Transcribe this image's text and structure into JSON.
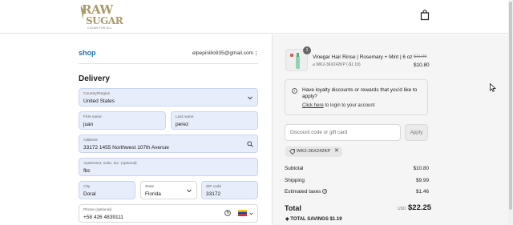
{
  "brand": {
    "logo_word_1": "RAW",
    "logo_word_2": "SUGAR",
    "tagline": "CLEAN FOR ALL"
  },
  "header": {
    "bag_icon": "shopping-bag-icon"
  },
  "account": {
    "shop_label": "shop",
    "email": "elpepinillo935@gmail.com",
    "menu_glyph": "⋮"
  },
  "delivery": {
    "title": "Delivery",
    "country": {
      "label": "Country/Region",
      "value": "United States"
    },
    "first_name": {
      "label": "First name",
      "value": "juan"
    },
    "last_name": {
      "label": "Last name",
      "value": "perez"
    },
    "address": {
      "label": "Address",
      "value": "33172 1455 Northwest 107th Avenue"
    },
    "apartment": {
      "label": "Apartment, suite, etc. (optional)",
      "value": "fbc"
    },
    "city": {
      "label": "City",
      "value": "Doral"
    },
    "state": {
      "label": "State",
      "value": "Florida"
    },
    "zip": {
      "label": "ZIP code",
      "value": "33172"
    },
    "phone": {
      "label": "Phone (optional)",
      "value": "+58 426 4839111"
    }
  },
  "order": {
    "item": {
      "quantity": "1",
      "name": "Vinegar Hair Rinse | Rosemary + Mint | 6 oz",
      "discount_code": "WK2-36X242KP (-$1.19)",
      "original_price": "$11.99",
      "price": "$10.80"
    },
    "loyalty": {
      "question": "Have loyalty discounts or rewards that you'd like to apply?",
      "link_text": "Click here",
      "link_suffix": " to login to your account"
    },
    "discount_placeholder": "Discount code or gift card",
    "apply_label": "Apply",
    "applied_code": "WK2-36X242KP",
    "subtotal_label": "Subtotal",
    "subtotal": "$10.80",
    "shipping_label": "Shipping",
    "shipping": "$9.99",
    "taxes_label": "Estimated taxes",
    "taxes": "$1.46",
    "total_label": "Total",
    "currency": "USD",
    "total": "$22.25",
    "savings_label": "TOTAL SAVINGS",
    "savings": "$1.19"
  },
  "colors": {
    "accent": "#1773b0",
    "field_bg": "#e8edfb",
    "summary_bg": "#f5f5f5"
  }
}
